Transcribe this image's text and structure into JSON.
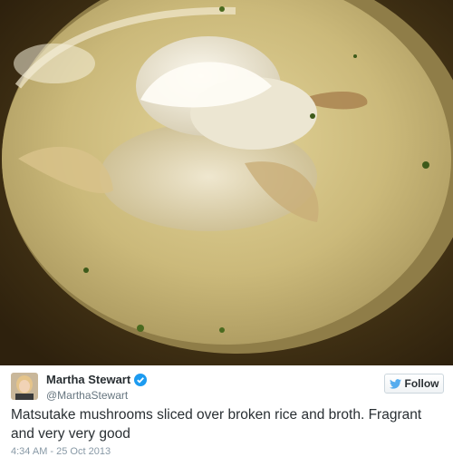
{
  "photo": {
    "description_icon": "food-photo"
  },
  "tweet": {
    "author_name": "Martha Stewart",
    "author_handle": "@MarthaStewart",
    "follow_label": "Follow",
    "text": "Matsutake mushrooms sliced over broken rice and broth. Fragrant and very very good",
    "timestamp": "4:34 AM - 25 Oct 2013"
  },
  "colors": {
    "twitter_blue": "#55acee",
    "verified_blue": "#1d9bf0"
  }
}
